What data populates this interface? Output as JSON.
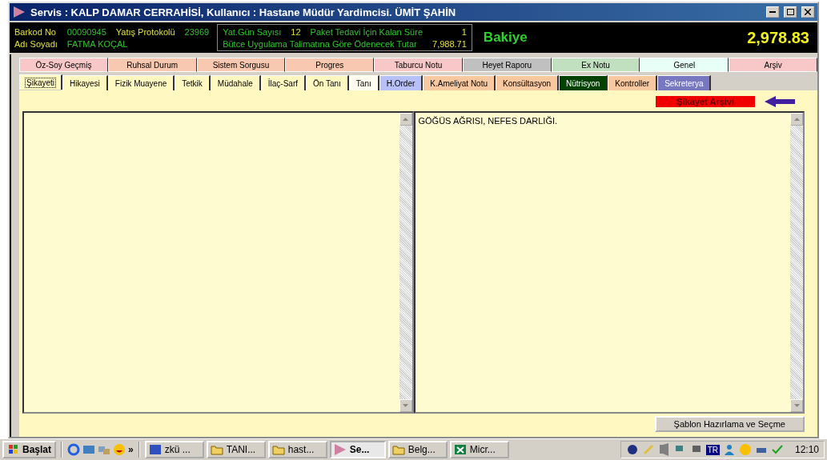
{
  "window": {
    "title": "Servis : KALP DAMAR CERRAHİSİ, Kullanıcı : Hastane Müdür Yardimcisi. ÜMİT ŞAHİN"
  },
  "header": {
    "barcode_label": "Barkod No",
    "barcode": "00090945",
    "protocol_label": "Yatış Protokolü",
    "protocol": "23969",
    "name_label": "Adı Soyadı",
    "name": "FATMA KOÇAL",
    "days_label": "Yat.Gün Sayısı",
    "days": "12",
    "remaining_label": "Paket Tedavi İçin Kalan Süre",
    "remaining": "1",
    "budget_label": "Bütce Uygulama Talimatına Göre  Ödenecek Tutar",
    "budget": "7,988.71",
    "balance_label": "Bakiye",
    "balance": "2,978.83"
  },
  "tabs_top": [
    {
      "label": "Öz-Soy Geçmiş",
      "color": "#f8c8c8"
    },
    {
      "label": "Ruhsal Durum",
      "color": "#f8c8b0"
    },
    {
      "label": "Sistem Sorgusu",
      "color": "#f8c8b0"
    },
    {
      "label": "Progres",
      "color": "#f8c8b0"
    },
    {
      "label": "Taburcu Notu",
      "color": "#f8c8c8"
    },
    {
      "label": "Heyet Raporu",
      "color": "#c0c0c0"
    },
    {
      "label": "Ex Notu",
      "color": "#c0e0c0"
    },
    {
      "label": "Genel",
      "color": "#e8fff8"
    },
    {
      "label": "Arşiv",
      "color": "#f8c8c8"
    }
  ],
  "tabs": [
    {
      "label": "Şikayeti",
      "selected": true,
      "color": "#fff8c0"
    },
    {
      "label": "Hikayesi",
      "selected": false,
      "color": "#fff8c0"
    },
    {
      "label": "Fizik Muayene",
      "selected": false,
      "color": "#fff8c0"
    },
    {
      "label": "Tetkik",
      "selected": false,
      "color": "#fff8c0"
    },
    {
      "label": "Müdahale",
      "selected": false,
      "color": "#fff8c0"
    },
    {
      "label": "İlaç-Sarf",
      "selected": false,
      "color": "#fff8c0"
    },
    {
      "label": "Ön Tanı",
      "selected": false,
      "color": "#fff8c0"
    },
    {
      "label": "Tanı",
      "selected": false,
      "color": "#fffcf0"
    },
    {
      "label": "H.Order",
      "selected": false,
      "color": "#b8c0f8"
    },
    {
      "label": "K.Ameliyat Notu",
      "selected": false,
      "color": "#f8c8a0"
    },
    {
      "label": "Konsültasyon",
      "selected": false,
      "color": "#f8c8a0"
    },
    {
      "label": "Nütrisyon",
      "selected": false,
      "color": "#004000"
    },
    {
      "label": "Kontroller",
      "selected": false,
      "color": "#f8c8a0"
    },
    {
      "label": "Sekreterya",
      "selected": false,
      "color": "#7878c0"
    }
  ],
  "archive_label": "Şikayet Arşivi",
  "right_text": "GÖĞÜS AĞRISI, NEFES DARLIĞI.",
  "template_button": "Şablon Hazırlama ve Seçme",
  "taskbar": {
    "start": "Başlat",
    "more": "»",
    "tasks": [
      {
        "label": "zkü ...",
        "selected": false,
        "kind": "doc"
      },
      {
        "label": "TANI...",
        "selected": false,
        "kind": "folder"
      },
      {
        "label": "hast...",
        "selected": false,
        "kind": "folder"
      },
      {
        "label": "Se...",
        "selected": true,
        "kind": "app"
      },
      {
        "label": "Belg...",
        "selected": false,
        "kind": "folder"
      },
      {
        "label": "Micr...",
        "selected": false,
        "kind": "sheet"
      }
    ],
    "language": "TR",
    "clock": "12:10"
  }
}
